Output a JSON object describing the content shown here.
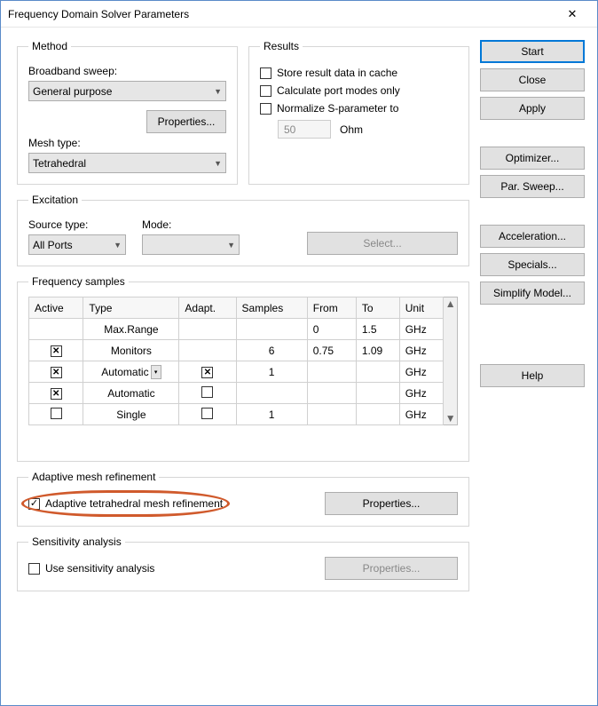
{
  "window": {
    "title": "Frequency Domain Solver Parameters"
  },
  "method": {
    "legend": "Method",
    "broadband_label": "Broadband sweep:",
    "broadband_value": "General purpose",
    "properties_btn": "Properties...",
    "mesh_type_label": "Mesh type:",
    "mesh_type_value": "Tetrahedral"
  },
  "results": {
    "legend": "Results",
    "store_cache": "Store result data in cache",
    "calc_port_modes": "Calculate port modes only",
    "normalize_sparam": "Normalize S-parameter to",
    "ohm_value": "50",
    "ohm_unit": "Ohm"
  },
  "excitation": {
    "legend": "Excitation",
    "source_type_label": "Source type:",
    "source_type_value": "All Ports",
    "mode_label": "Mode:",
    "mode_value": "",
    "select_btn": "Select..."
  },
  "freq": {
    "legend": "Frequency samples",
    "headers": {
      "active": "Active",
      "type": "Type",
      "adapt": "Adapt.",
      "samples": "Samples",
      "from": "From",
      "to": "To",
      "unit": "Unit"
    },
    "rows": [
      {
        "active": "",
        "type": "Max.Range",
        "adapt": "",
        "samples": "",
        "from": "0",
        "to": "1.5",
        "unit": "GHz",
        "type_dd": false,
        "active_chk": null,
        "adapt_chk": null
      },
      {
        "active": "x",
        "type": "Monitors",
        "adapt": "",
        "samples": "6",
        "from": "0.75",
        "to": "1.09",
        "unit": "GHz",
        "type_dd": false,
        "adapt_chk": null
      },
      {
        "active": "x",
        "type": "Automatic",
        "adapt": "x",
        "samples": "1",
        "from": "",
        "to": "",
        "unit": "GHz",
        "type_dd": true
      },
      {
        "active": "x",
        "type": "Automatic",
        "adapt": "",
        "samples": "",
        "from": "",
        "to": "",
        "unit": "GHz",
        "type_dd": false,
        "adapt_chk": ""
      },
      {
        "active": "",
        "type": "Single",
        "adapt": "",
        "samples": "1",
        "from": "",
        "to": "",
        "unit": "GHz",
        "type_dd": false,
        "active_chk": "",
        "adapt_chk": ""
      }
    ]
  },
  "adaptive": {
    "legend": "Adaptive mesh refinement",
    "checkbox_label": "Adaptive tetrahedral mesh refinement",
    "properties_btn": "Properties..."
  },
  "sensitivity": {
    "legend": "Sensitivity analysis",
    "checkbox_label": "Use sensitivity analysis",
    "properties_btn": "Properties..."
  },
  "buttons": {
    "start": "Start",
    "close": "Close",
    "apply": "Apply",
    "optimizer": "Optimizer...",
    "par_sweep": "Par. Sweep...",
    "acceleration": "Acceleration...",
    "specials": "Specials...",
    "simplify": "Simplify Model...",
    "help": "Help"
  }
}
